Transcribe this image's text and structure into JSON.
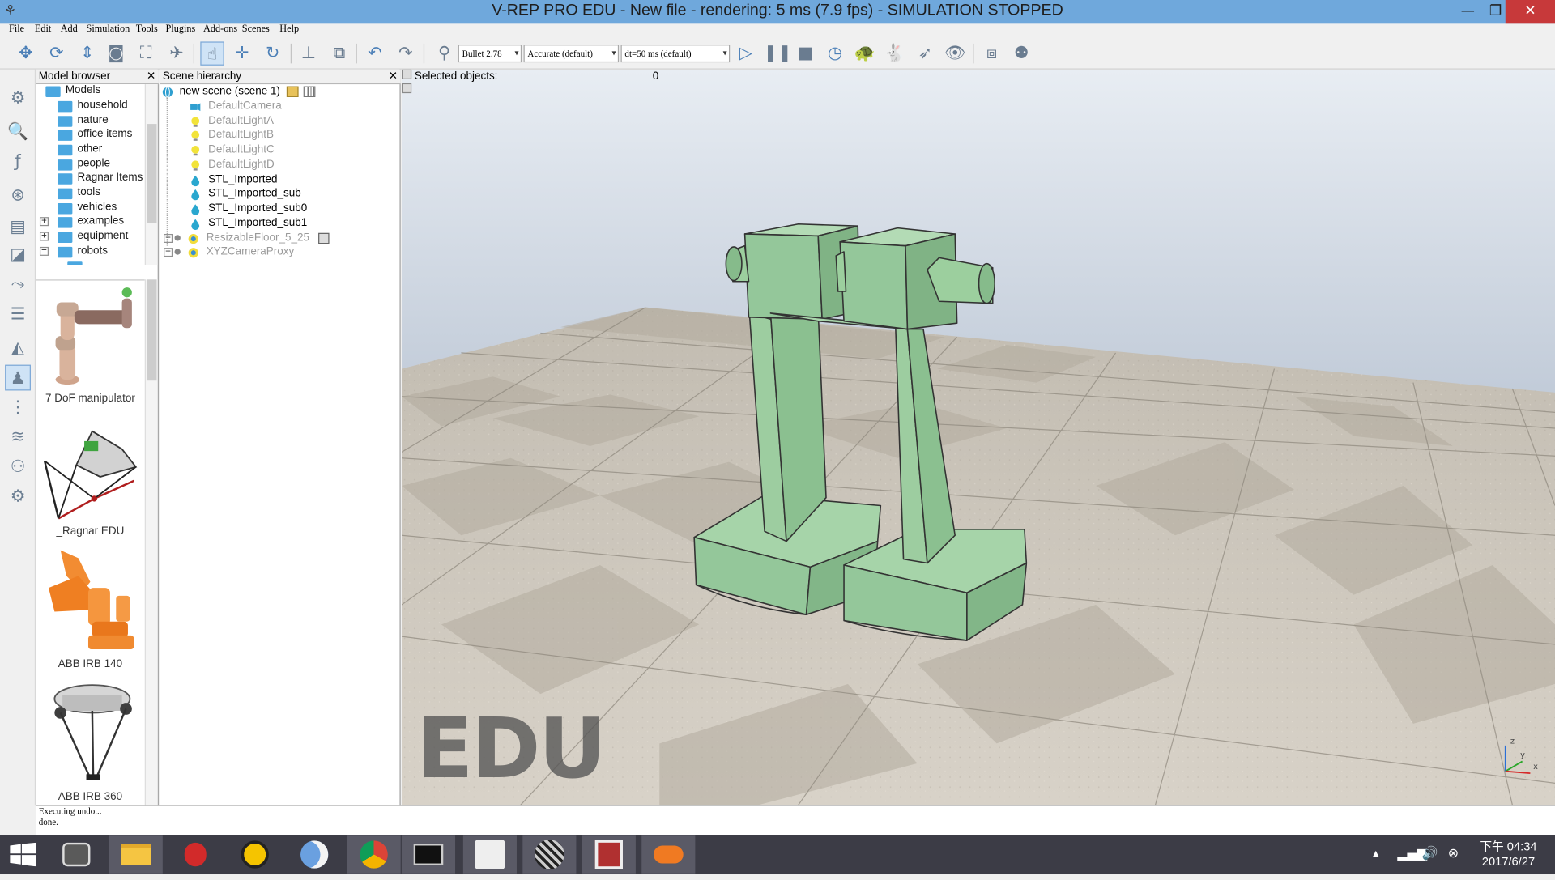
{
  "window": {
    "title": "V-REP PRO EDU - New file - rendering: 5 ms (7.9 fps) - SIMULATION STOPPED",
    "minimize": "—",
    "maximize": "❐",
    "close": "✕"
  },
  "menu": [
    "File",
    "Edit",
    "Add",
    "Simulation",
    "Tools",
    "Plugins",
    "Add-ons",
    "Scenes",
    "Help"
  ],
  "toolbar": {
    "engine": "Bullet 2.78",
    "accuracy": "Accurate (default)",
    "timestep": "dt=50 ms (default)",
    "combo_arrow": "▾"
  },
  "model_browser": {
    "title": "Model browser",
    "close": "✕",
    "root": "Models",
    "folders": [
      "household",
      "nature",
      "office items",
      "other",
      "people",
      "Ragnar Items",
      "tools",
      "vehicles",
      "examples",
      "equipment",
      "robots"
    ],
    "thumbnails": [
      "7 DoF manipulator",
      "_Ragnar EDU",
      "ABB IRB 140",
      "ABB IRB 360"
    ]
  },
  "scene_hierarchy": {
    "title": "Scene hierarchy",
    "close": "✕",
    "scene": "new scene (scene 1)",
    "objects": [
      {
        "name": "DefaultCamera",
        "icon": "camera-icon"
      },
      {
        "name": "DefaultLightA",
        "icon": "light-icon"
      },
      {
        "name": "DefaultLightB",
        "icon": "light-icon"
      },
      {
        "name": "DefaultLightC",
        "icon": "light-icon"
      },
      {
        "name": "DefaultLightD",
        "icon": "light-icon"
      },
      {
        "name": "STL_Imported",
        "icon": "shape-icon"
      },
      {
        "name": "STL_Imported_sub",
        "icon": "shape-icon"
      },
      {
        "name": "STL_Imported_sub0",
        "icon": "shape-icon"
      },
      {
        "name": "STL_Imported_sub1",
        "icon": "shape-icon"
      },
      {
        "name": "ResizableFloor_5_25",
        "icon": "model-icon"
      },
      {
        "name": "XYZCameraProxy",
        "icon": "model-icon"
      }
    ]
  },
  "viewport": {
    "selected_label": "Selected objects:",
    "selected_count": "0",
    "watermark": "EDU",
    "axis_z": "z",
    "axis_y": "y",
    "axis_x": "x"
  },
  "status": {
    "line1": "Executing undo...",
    "line2": "done."
  },
  "taskbar": {
    "clock_line1": "下午 04:34",
    "clock_line2": "2017/6/27"
  },
  "colors": {
    "titlebar": "#6fa8dc",
    "close": "#c7393a",
    "shape": "#94c79a",
    "folder": "#4aa7e0",
    "taskbar": "#3c3c46"
  }
}
